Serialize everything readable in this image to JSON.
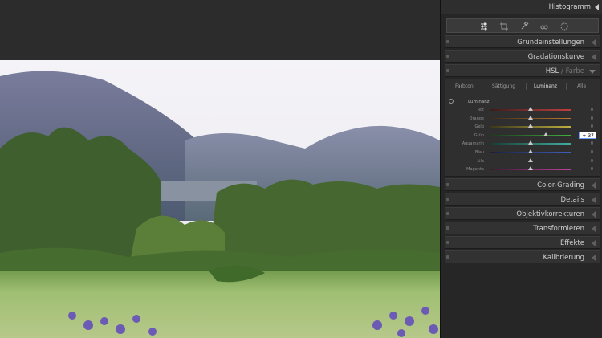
{
  "header": {
    "title": "Histogramm"
  },
  "toolbar": {
    "tools": [
      "sliders-icon",
      "crop-rotate-icon",
      "healing-brush-icon",
      "red-eye-icon",
      "mask-icon"
    ]
  },
  "panels": {
    "grundeinstellungen": "Grundeinstellungen",
    "gradationskurve": "Gradationskurve",
    "hsl_title_a": "HSL",
    "hsl_title_sep": " / ",
    "hsl_title_b": "Farbe",
    "color_grading": "Color-Grading",
    "details": "Details",
    "objektivkorrekturen": "Objektivkorrekturen",
    "transformieren": "Transformieren",
    "effekte": "Effekte",
    "kalibrierung": "Kalibrierung"
  },
  "hsl": {
    "tabs": [
      "Farbton",
      "Sättigung",
      "Luminanz",
      "Alle"
    ],
    "active_tab": "Luminanz",
    "section_title": "Luminanz",
    "rows": [
      {
        "name": "Rot",
        "value": "0",
        "level": 0
      },
      {
        "name": "Orange",
        "value": "0",
        "level": 0
      },
      {
        "name": "Gelb",
        "value": "0",
        "level": 0
      },
      {
        "name": "Grün",
        "value": "+ 37",
        "level": 37,
        "editing": true
      },
      {
        "name": "Aquamarin",
        "value": "0",
        "level": 0
      },
      {
        "name": "Blau",
        "value": "0",
        "level": 0
      },
      {
        "name": "Lila",
        "value": "0",
        "level": 0
      },
      {
        "name": "Magenta",
        "value": "0",
        "level": 0
      }
    ],
    "track_colors": [
      [
        "#3b1c1c",
        "#c04040"
      ],
      [
        "#3b2a1a",
        "#c07a30"
      ],
      [
        "#3a361a",
        "#c0b040"
      ],
      [
        "#1c3a1c",
        "#40b040"
      ],
      [
        "#1a3a36",
        "#40b0a0"
      ],
      [
        "#1a1e3a",
        "#4060c0"
      ],
      [
        "#2a1a3a",
        "#8040c0"
      ],
      [
        "#3a1a30",
        "#c040a0"
      ]
    ]
  },
  "colors": {
    "accent": "#6aa0ff"
  }
}
